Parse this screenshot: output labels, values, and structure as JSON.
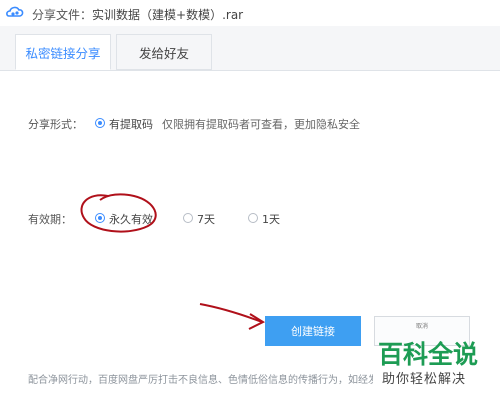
{
  "window": {
    "title_prefix": "分享文件：",
    "file_name": "实训数据（建模+数模）.rar"
  },
  "tabs": [
    {
      "label": "私密链接分享",
      "active": true
    },
    {
      "label": "发给好友",
      "active": false
    }
  ],
  "share_form": {
    "label": "分享形式：",
    "option": "有提取码",
    "checked": true,
    "hint": "仅限拥有提取码者可查看，更加隐私安全"
  },
  "validity": {
    "label": "有效期：",
    "options": [
      {
        "label": "永久有效",
        "checked": true
      },
      {
        "label": "7天",
        "checked": false
      },
      {
        "label": "1天",
        "checked": false
      }
    ]
  },
  "buttons": {
    "create": "创建链接",
    "cancel": "取消"
  },
  "footer_text": "配合净网行动，百度网盘严厉打击不良信息、色情低俗信息的传播行为，如经发现",
  "watermark": {
    "main": "百科全说",
    "sub": "助你轻松解决"
  },
  "colors": {
    "accent": "#3b8cff",
    "button": "#3e9ff2",
    "annotation": "#b0101a",
    "watermark_green": "#1d9c54"
  }
}
